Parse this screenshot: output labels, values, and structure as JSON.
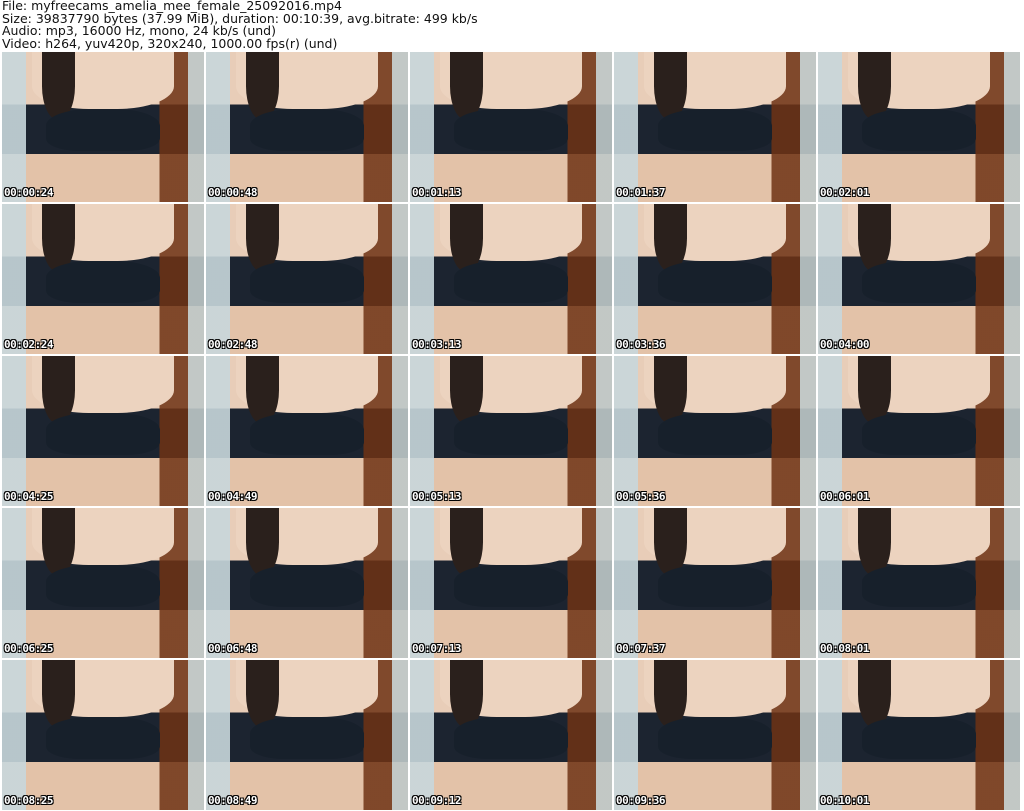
{
  "header": {
    "file": "File: myfreecams_amelia_mee_female_25092016.mp4",
    "size": "Size: 39837790 bytes (37.99 MiB), duration: 00:10:39, avg.bitrate: 499 kb/s",
    "audio": "Audio: mp3, 16000 Hz, mono, 24 kb/s (und)",
    "video": "Video: h264, yuv420p, 320x240, 1000.00 fps(r) (und)"
  },
  "thumbnails": [
    {
      "timestamp": "00:00:24"
    },
    {
      "timestamp": "00:00:48"
    },
    {
      "timestamp": "00:01:13"
    },
    {
      "timestamp": "00:01:37"
    },
    {
      "timestamp": "00:02:01"
    },
    {
      "timestamp": "00:02:24"
    },
    {
      "timestamp": "00:02:48"
    },
    {
      "timestamp": "00:03:13"
    },
    {
      "timestamp": "00:03:36"
    },
    {
      "timestamp": "00:04:00"
    },
    {
      "timestamp": "00:04:25"
    },
    {
      "timestamp": "00:04:49"
    },
    {
      "timestamp": "00:05:13"
    },
    {
      "timestamp": "00:05:36"
    },
    {
      "timestamp": "00:06:01"
    },
    {
      "timestamp": "00:06:25"
    },
    {
      "timestamp": "00:06:48"
    },
    {
      "timestamp": "00:07:13"
    },
    {
      "timestamp": "00:07:37"
    },
    {
      "timestamp": "00:08:01"
    },
    {
      "timestamp": "00:08:25"
    },
    {
      "timestamp": "00:08:49"
    },
    {
      "timestamp": "00:09:12"
    },
    {
      "timestamp": "00:09:36"
    },
    {
      "timestamp": "00:10:01"
    }
  ]
}
